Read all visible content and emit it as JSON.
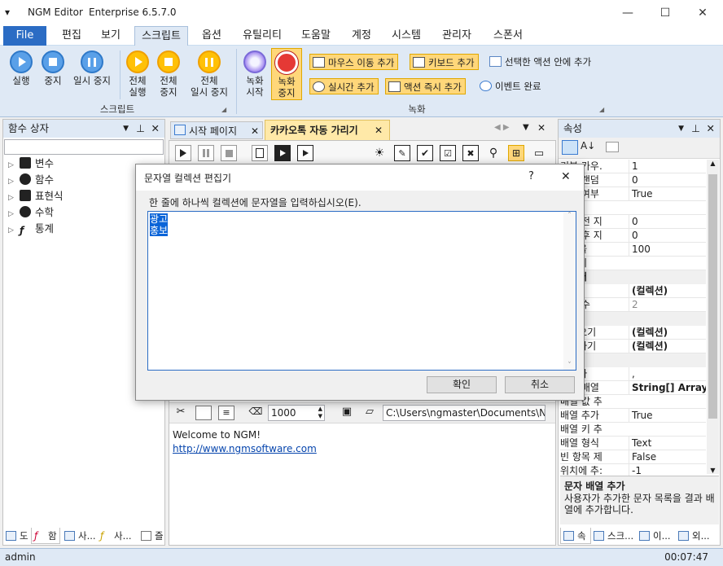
{
  "window": {
    "app_name": "NGM Editor",
    "edition": "Enterprise 6.5.7.0",
    "minimize": "—",
    "maximize": "☐",
    "close": "✕",
    "system_menu": "▾"
  },
  "menu": {
    "items": [
      "File",
      "편집",
      "보기",
      "스크립트",
      "옵션",
      "유틸리티",
      "도움말",
      "계정",
      "시스템",
      "관리자",
      "스폰서"
    ],
    "active": "스크립트",
    "file_color": "#2b6cc4"
  },
  "ribbon": {
    "script_group": {
      "label": "스크립트",
      "run": "실행",
      "stop": "중지",
      "pause": "일시 중지",
      "run_all": [
        "전체",
        "실행"
      ],
      "stop_all": [
        "전체",
        "중지"
      ],
      "pause_all": [
        "전체",
        "일시 중지"
      ]
    },
    "record_group": {
      "label": "녹화",
      "record_start": [
        "녹화",
        "시작"
      ],
      "record_stop": [
        "녹화",
        "중지"
      ],
      "add_mouse_move": "마우스 이동 추가",
      "add_keyboard": "키보드 추가",
      "add_into_selected": "선택한 액션 안에 추가",
      "add_realtime": "실시간 추가",
      "add_action_now": "액션 즉시 추가",
      "event_done": "이벤트 완료"
    }
  },
  "left_panel": {
    "title": "함수 상자",
    "search_placeholder": "",
    "tree": [
      "변수",
      "함수",
      "표현식",
      "수학",
      "통계"
    ],
    "bottom_tabs": [
      "도",
      "함",
      "사...",
      "사...",
      "즐"
    ]
  },
  "doc_tabs": {
    "tab1": "시작 페이지",
    "tab2": "카카오톡 자동 가리기"
  },
  "output": {
    "font_size": "1000",
    "path": "C:\\Users\\ngmaster\\Documents\\NGM",
    "welcome": "Welcome to NGM!",
    "link": "http://www.ngmsoftware.com"
  },
  "properties": {
    "title": "속성",
    "rows": [
      {
        "type": "prop",
        "name": "기본 가우.",
        "value": "1"
      },
      {
        "type": "prop",
        "name": "기본 랜덤",
        "value": "0"
      },
      {
        "type": "prop",
        "name": "사용 여부",
        "value": "True"
      },
      {
        "type": "prop",
        "name": "설명",
        "value": ""
      },
      {
        "type": "prop",
        "name": "실행 전 지",
        "value": "0"
      },
      {
        "type": "prop",
        "name": "실행 후 지",
        "value": "0"
      },
      {
        "type": "prop",
        "name": "실행율",
        "value": "100"
      },
      {
        "type": "prop",
        "name": "아이디",
        "value": ""
      },
      {
        "type": "cat",
        "name": "데이터",
        "value": ""
      },
      {
        "type": "prop",
        "name": "배열",
        "value": "(컬렉션)",
        "bold": true
      },
      {
        "type": "prop",
        "name": "배열 수",
        "value": "2",
        "gray": true
      },
      {
        "type": "cat",
        "name": "변수",
        "value": ""
      },
      {
        "type": "prop",
        "name": "가져오기",
        "value": "(컬렉션)",
        "bold": true
      },
      {
        "type": "prop",
        "name": "추가하기",
        "value": "(컬렉션)",
        "bold": true
      },
      {
        "type": "cat",
        "name": "작업",
        "value": ""
      },
      {
        "type": "prop",
        "name": "구분자",
        "value": ","
      },
      {
        "type": "prop",
        "name": "문자 배열",
        "value": "String[] Array",
        "bold": true
      },
      {
        "type": "prop",
        "name": "배열 값 추",
        "value": ""
      },
      {
        "type": "prop",
        "name": "배열 추가",
        "value": "True"
      },
      {
        "type": "prop",
        "name": "배열 키 추",
        "value": ""
      },
      {
        "type": "prop",
        "name": "배열 형식",
        "value": "Text"
      },
      {
        "type": "prop",
        "name": "빈 항목 제",
        "value": "False"
      },
      {
        "type": "prop",
        "name": "위치에 추:",
        "value": "-1"
      }
    ],
    "desc_title": "문자 배열 추가",
    "desc_text": "사용자가 추가한 문자 목록을 결과 배열에 추가합니다.",
    "bottom_tabs": [
      "속",
      "스크...",
      "이...",
      "외..."
    ]
  },
  "dialog": {
    "title": "문자열 컬렉션 편집기",
    "help": "?",
    "close": "✕",
    "instruction": "한 줄에 하나씩 컬렉션에 문자열을 입력하십시오(E).",
    "lines": [
      "광고",
      "홍보"
    ],
    "ok": "확인",
    "cancel": "취소"
  },
  "status": {
    "user": "admin",
    "time": "00:07:47"
  }
}
